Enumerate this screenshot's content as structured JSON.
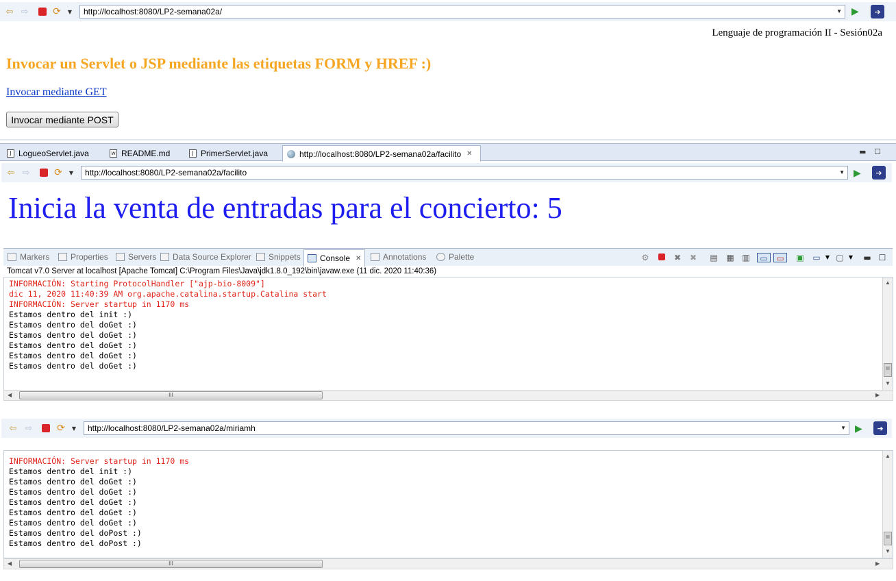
{
  "browser1": {
    "url": "http://localhost:8080/LP2-semana02a/"
  },
  "page1": {
    "course_label": "Lenguaje de programación II - Sesión02a",
    "heading": "Invocar un Servlet o JSP mediante las etiquetas FORM y HREF :)",
    "get_link": "Invocar mediante GET",
    "post_button": "Invocar mediante POST"
  },
  "editor_tabs": [
    {
      "label": "LogueoServlet.java",
      "icon": "java-file-icon"
    },
    {
      "label": "README.md",
      "icon": "text-file-icon"
    },
    {
      "label": "PrimerServlet.java",
      "icon": "java-file-icon"
    },
    {
      "label": "http://localhost:8080/LP2-semana02a/facilito",
      "icon": "globe-icon",
      "active": true
    }
  ],
  "browser2": {
    "url": "http://localhost:8080/LP2-semana02a/facilito"
  },
  "page2": {
    "heading": "Inicia la venta de entradas para el concierto: 5"
  },
  "views": [
    {
      "label": "Markers"
    },
    {
      "label": "Properties"
    },
    {
      "label": "Servers"
    },
    {
      "label": "Data Source Explorer"
    },
    {
      "label": "Snippets"
    },
    {
      "label": "Console",
      "active": true
    },
    {
      "label": "Annotations"
    },
    {
      "label": "Palette"
    }
  ],
  "console1": {
    "description": "Tomcat v7.0 Server at localhost [Apache Tomcat] C:\\Program Files\\Java\\jdk1.8.0_192\\bin\\javaw.exe  (11 dic. 2020 11:40:36)",
    "lines": [
      {
        "text": "INFORMACIÓN: Starting ProtocolHandler [\"ajp-bio-8009\"]",
        "color": "red"
      },
      {
        "text": "dic 11, 2020 11:40:39 AM org.apache.catalina.startup.Catalina start",
        "color": "red"
      },
      {
        "text": "INFORMACIÓN: Server startup in 1170 ms",
        "color": "red"
      },
      {
        "text": "Estamos dentro del init :)",
        "color": "black"
      },
      {
        "text": "Estamos dentro del doGet :)",
        "color": "black"
      },
      {
        "text": "Estamos dentro del doGet :)",
        "color": "black"
      },
      {
        "text": "Estamos dentro del doGet :)",
        "color": "black"
      },
      {
        "text": "Estamos dentro del doGet :)",
        "color": "black"
      },
      {
        "text": "Estamos dentro del doGet :)",
        "color": "black"
      }
    ]
  },
  "browser3": {
    "url": "http://localhost:8080/LP2-semana02a/miriamh"
  },
  "console2": {
    "lines": [
      {
        "text": "INFORMACIÓN: Server startup in 1170 ms",
        "color": "red"
      },
      {
        "text": "Estamos dentro del init :)",
        "color": "black"
      },
      {
        "text": "Estamos dentro del doGet :)",
        "color": "black"
      },
      {
        "text": "Estamos dentro del doGet :)",
        "color": "black"
      },
      {
        "text": "Estamos dentro del doGet :)",
        "color": "black"
      },
      {
        "text": "Estamos dentro del doGet :)",
        "color": "black"
      },
      {
        "text": "Estamos dentro del doGet :)",
        "color": "black"
      },
      {
        "text": "Estamos dentro del doPost :)",
        "color": "black"
      },
      {
        "text": "Estamos dentro del doPost :)",
        "color": "black"
      }
    ]
  },
  "scroll_thumb_glyph": "III",
  "colors": {
    "heading_orange": "#f5a623",
    "link_blue": "#0a37c8",
    "big_text_blue": "#1d1df0",
    "console_red": "#e0251a"
  }
}
